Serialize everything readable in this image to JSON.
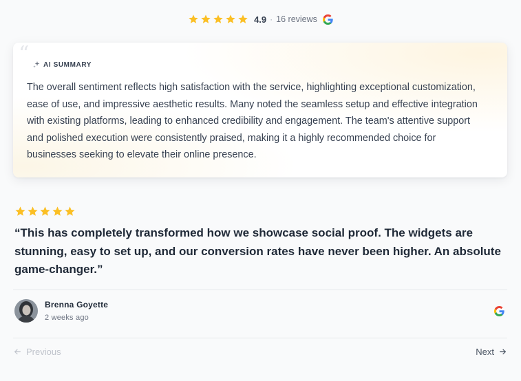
{
  "header": {
    "star_count": 5,
    "rating_value": "4.9",
    "separator": "·",
    "review_count": "16 reviews",
    "source_icon": "google-g-icon"
  },
  "summary": {
    "quote_glyph": "“",
    "label": "AI SUMMARY",
    "icon": "sparkle-icon",
    "text": "The overall sentiment reflects high satisfaction with the service, highlighting exceptional customization, ease of use, and impressive aesthetic results. Many noted the seamless setup and effective integration with existing platforms, leading to enhanced credibility and engagement. The team's attentive support and polished execution were consistently praised, making it a highly recommended choice for businesses seeking to elevate their online presence."
  },
  "review": {
    "rating": 5,
    "quote": "“This has completely transformed how we showcase social proof. The widgets are stunning, easy to set up, and our conversion rates have never been higher. An absolute game-changer.”",
    "author_name": "Brenna Goyette",
    "date": "2 weeks ago",
    "source_icon": "google-g-icon"
  },
  "pagination": {
    "previous_label": "Previous",
    "next_label": "Next"
  },
  "colors": {
    "star": "#fbbf24",
    "background": "#f9fafb",
    "card": "#ffffff",
    "text_primary": "#1f2937",
    "text_muted": "#6b7280",
    "disabled": "#c0c4cc"
  }
}
